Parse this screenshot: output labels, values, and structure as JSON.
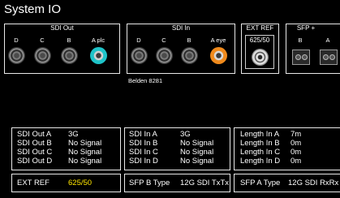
{
  "title": "System IO",
  "sdi_out": {
    "title": "SDI Out",
    "ports": [
      "D",
      "C",
      "B",
      "A plc"
    ]
  },
  "sdi_in": {
    "title": "SDI In",
    "ports": [
      "D",
      "C",
      "B",
      "A eye"
    ],
    "cable": "Belden 8281"
  },
  "ext_ref": {
    "title": "EXT REF",
    "format": "625/50"
  },
  "sfp": {
    "title": "SFP +",
    "ports": [
      "B",
      "A"
    ]
  },
  "status_out": [
    {
      "label": "SDI Out A",
      "value": "3G"
    },
    {
      "label": "SDI Out B",
      "value": "No Signal"
    },
    {
      "label": "SDI Out C",
      "value": "No Signal"
    },
    {
      "label": "SDI Out D",
      "value": "No Signal"
    }
  ],
  "status_in": [
    {
      "label": "SDI In A",
      "value": "3G"
    },
    {
      "label": "SDI In B",
      "value": "No Signal"
    },
    {
      "label": "SDI In C",
      "value": "No Signal"
    },
    {
      "label": "SDI In D",
      "value": "No Signal"
    }
  ],
  "status_length": [
    {
      "label": "Length In A",
      "value": "7m"
    },
    {
      "label": "Length In B",
      "value": "0m"
    },
    {
      "label": "Length In C",
      "value": "0m"
    },
    {
      "label": "Length In D",
      "value": "0m"
    }
  ],
  "bottom": {
    "ext_ref_label": "EXT REF",
    "ext_ref_value": "625/50",
    "sfp_b_label": "SFP B Type",
    "sfp_b_value": "12G SDI TxTx",
    "sfp_a_label": "SFP A Type",
    "sfp_a_value": "12G SDI RxRx"
  },
  "colors": {
    "background": "#000000",
    "accent_yellow": "#ffe600",
    "port_cyan": "#1ec3c8",
    "port_orange": "#f08a1c"
  }
}
